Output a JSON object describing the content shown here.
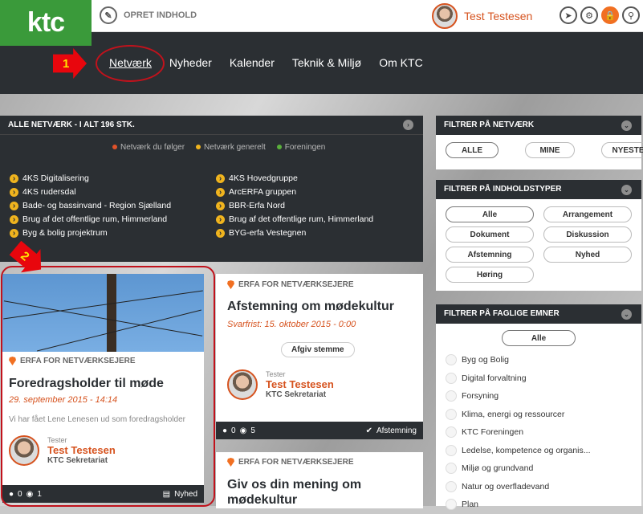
{
  "topbar": {
    "logo": "ktc",
    "opret_label": "OPRET INDHOLD",
    "user_name": "Test Testesen",
    "icons": [
      "tag-icon",
      "gear-icon",
      "lock-icon",
      "search-icon"
    ]
  },
  "nav": {
    "items": [
      "Netværk",
      "Nyheder",
      "Kalender",
      "Teknik & Miljø",
      "Om KTC"
    ],
    "active": "Netværk"
  },
  "markers": {
    "m1": "1",
    "m2": "2"
  },
  "networks": {
    "header": "ALLE NETVÆRK - I ALT 196 STK.",
    "legend": [
      {
        "label": "Netværk du følger",
        "color": "#e0522a"
      },
      {
        "label": "Netværk generelt",
        "color": "#f0b41e"
      },
      {
        "label": "Foreningen",
        "color": "#5ab03c"
      }
    ],
    "items": [
      "4KS Digitalisering",
      "4KS Hovedgruppe",
      "4KS rudersdal",
      "ArcERFA gruppen",
      "Bade- og bassinvand - Region Sjælland",
      "BBR-Erfa Nord",
      "Brug af det offentlige rum, Himmerland",
      "Brug af det offentlige rum, Himmerland",
      "Byg & bolig projektrum",
      "BYG-erfa Vestegnen"
    ]
  },
  "cards": {
    "c1": {
      "category": "ERFA FOR NETVÆRKSEJERE",
      "title": "Foredragsholder til møde",
      "date": "29. september 2015 - 14:14",
      "desc": "Vi har fået Lene Lenesen ud som foredragsholder",
      "role": "Tester",
      "author": "Test Testesen",
      "org": "KTC Sekretariat",
      "comments": "0",
      "views": "1",
      "type": "Nyhed"
    },
    "c2": {
      "category": "ERFA FOR NETVÆRKSEJERE",
      "title": "Afstemning om mødekultur",
      "date": "Svarfrist: 15. oktober 2015 - 0:00",
      "button": "Afgiv stemme",
      "role": "Tester",
      "author": "Test Testesen",
      "org": "KTC Sekretariat",
      "comments": "0",
      "views": "5",
      "type": "Afstemning"
    },
    "c3": {
      "category": "ERFA FOR NETVÆRKSEJERE",
      "title": "Giv os din mening om mødekultur"
    }
  },
  "sidebar": {
    "network_filter": {
      "header": "FILTRER PÅ NETVÆRK",
      "options": [
        "ALLE",
        "MINE",
        "NYESTE"
      ]
    },
    "content_filter": {
      "header": "FILTRER PÅ INDHOLDSTYPER",
      "options": [
        "Alle",
        "Arrangement",
        "Dokument",
        "Diskussion",
        "Afstemning",
        "Nyhed",
        "Høring"
      ]
    },
    "topic_filter": {
      "header": "FILTRER PÅ FAGLIGE EMNER",
      "all": "Alle",
      "topics": [
        "Byg og Bolig",
        "Digital forvaltning",
        "Forsyning",
        "Klima, energi og ressourcer",
        "KTC Foreningen",
        "Ledelse, kompetence og organis...",
        "Miljø og grundvand",
        "Natur og overfladevand",
        "Plan"
      ]
    }
  }
}
